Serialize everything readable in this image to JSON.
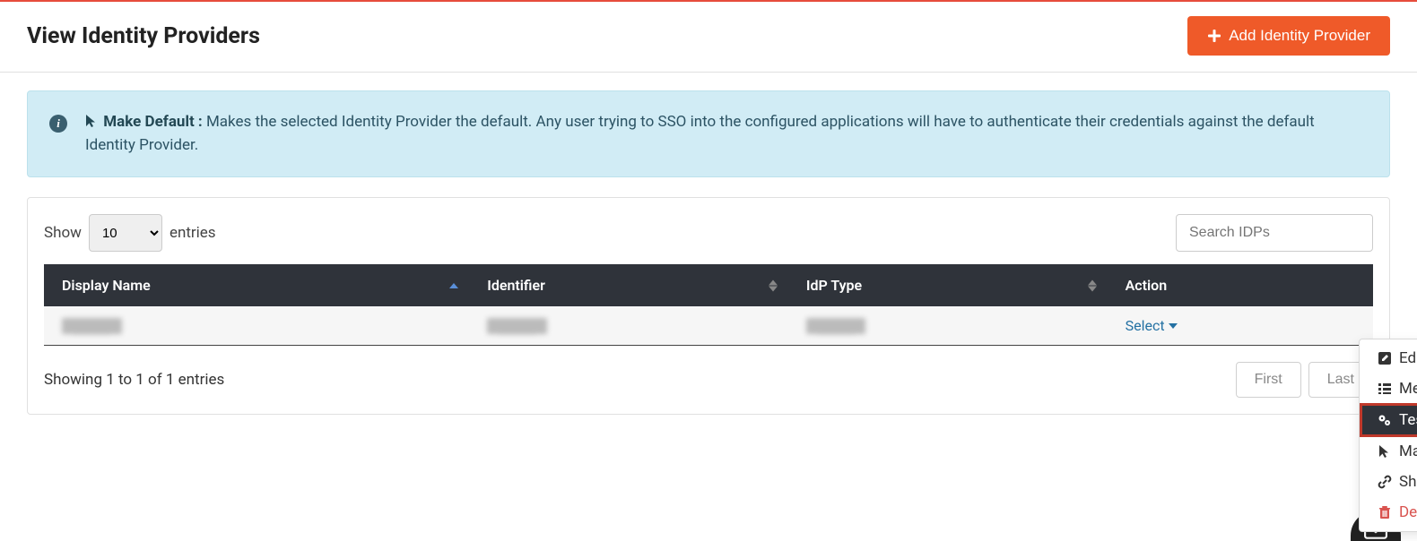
{
  "header": {
    "title": "View Identity Providers",
    "addButton": "Add Identity Provider"
  },
  "banner": {
    "strong": "Make Default :",
    "text": "Makes the selected Identity Provider the default. Any user trying to SSO into the configured applications will have to authenticate their credentials against the default Identity Provider."
  },
  "tableControls": {
    "showLabel": "Show",
    "entriesLabel": "entries",
    "pageSize": "10",
    "searchPlaceholder": "Search IDPs"
  },
  "columns": {
    "displayName": "Display Name",
    "identifier": "Identifier",
    "idpType": "IdP Type",
    "action": "Action"
  },
  "row": {
    "displayName": "████",
    "identifier": "████",
    "idpType": "████",
    "selectLabel": "Select"
  },
  "footer": {
    "info": "Showing 1 to 1 of 1 entries",
    "first": "First",
    "last": "Last"
  },
  "dropdown": {
    "edit": "Edit",
    "metadata": "Metadata",
    "testConnection": "Test Connection",
    "makeDefault": "Make Default",
    "showSSO": "Show SSO Link",
    "delete": "Delete"
  }
}
